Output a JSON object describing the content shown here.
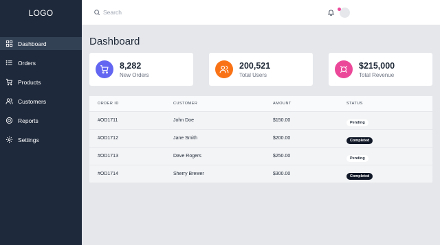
{
  "sidebar": {
    "logo": "LOGO",
    "items": [
      {
        "label": "Dashboard",
        "icon": "dashboard-icon",
        "active": true
      },
      {
        "label": "Orders",
        "icon": "list-icon"
      },
      {
        "label": "Products",
        "icon": "cart-icon"
      },
      {
        "label": "Customers",
        "icon": "users-icon"
      },
      {
        "label": "Reports",
        "icon": "reports-icon"
      },
      {
        "label": "Settings",
        "icon": "gear-icon"
      }
    ]
  },
  "topbar": {
    "search_placeholder": "Search",
    "notification_icon": "bell-icon"
  },
  "page": {
    "title": "Dashboard"
  },
  "stats": [
    {
      "value": "8,282",
      "label": "New Orders",
      "icon": "cart-icon",
      "color": "#6366f1"
    },
    {
      "value": "200,521",
      "label": "Total Users",
      "icon": "users-icon",
      "color": "#f97316"
    },
    {
      "value": "$215,000",
      "label": "Total Revenue",
      "icon": "revenue-icon",
      "color": "#ec4899"
    }
  ],
  "orders": {
    "columns": [
      "ORDER ID",
      "CUSTOMER",
      "AMOUNT",
      "STATUS"
    ],
    "rows": [
      {
        "id": "#OD1711",
        "customer": "John Doe",
        "amount": "$150.00",
        "status": "Pending"
      },
      {
        "id": "#OD1712",
        "customer": "Jane Smith",
        "amount": "$200.00",
        "status": "Completed"
      },
      {
        "id": "#OD1713",
        "customer": "Dave Rogers",
        "amount": "$250.00",
        "status": "Pending"
      },
      {
        "id": "#OD1714",
        "customer": "Sherry Brewer",
        "amount": "$300.00",
        "status": "Completed"
      }
    ]
  }
}
